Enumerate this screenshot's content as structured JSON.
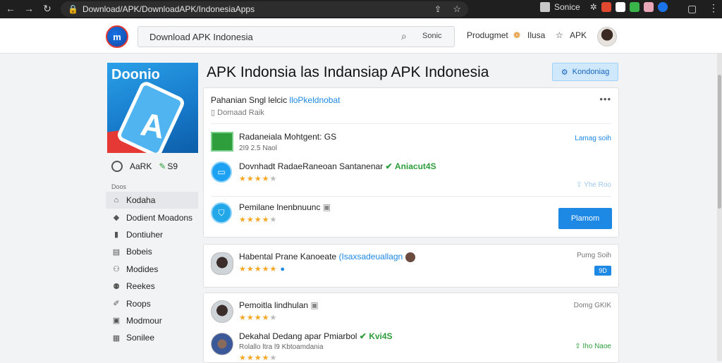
{
  "browser": {
    "url": "Download/APK/DownloadAPK/IndonesiaApps",
    "profile_label": "Sonice"
  },
  "header": {
    "logo_text": "m",
    "search_value": "Download APK Indonesia",
    "search_button": "Sonic",
    "links": [
      "Produgmet",
      "Ilusa",
      "APK"
    ]
  },
  "hero": {
    "title": "Doonio",
    "letter": "A"
  },
  "left": {
    "stats": [
      "AaRK",
      "S9"
    ],
    "section_label": "Doos",
    "items": [
      {
        "icon": "home-icon",
        "label": "Kodaha"
      },
      {
        "icon": "tag-icon",
        "label": "Dodient Moadons"
      },
      {
        "icon": "chart-icon",
        "label": "Dontiuher"
      },
      {
        "icon": "doc-icon",
        "label": "Bobeis"
      },
      {
        "icon": "users-icon",
        "label": "Modides"
      },
      {
        "icon": "people-icon",
        "label": "Reekes"
      },
      {
        "icon": "pen-icon",
        "label": "Roops"
      },
      {
        "icon": "monitor-icon",
        "label": "Modmour"
      },
      {
        "icon": "grid-icon",
        "label": "Sonilee"
      }
    ]
  },
  "main": {
    "page_title": "APK Indonsia las Indansiap APK Indonesia",
    "top_button": "Kondoniag",
    "card1": {
      "head_prefix": "Pahanian Sngl lelcic",
      "head_highlight": "lloPkeldnobat",
      "sub": "Domaad Raik",
      "rows": [
        {
          "title": "Radaneiala Mohtgent: GS",
          "meta": "2I9 2.5 Naol",
          "right": "Lamag soih"
        },
        {
          "title": "Dovnhadt RadaeRaneoan Santanenar",
          "title_green": "Aniacut4S",
          "stars": 4,
          "right": "Yhe Roo"
        },
        {
          "title": "Pemilane lnenbnuunc",
          "stars": 4,
          "button": "Plamom"
        }
      ]
    },
    "card2": {
      "title": "Habental Prane Kanoeate",
      "title_blue": "(Isaxsadeuallagn",
      "stars": 5,
      "right": "Pumg Soih",
      "badge": "9D"
    },
    "card3": {
      "rows": [
        {
          "title": "Pemoitla lindhulan",
          "stars": 4,
          "right": "Domg GKIK"
        },
        {
          "title": "Dekahal Dedang apar Pmiarbol",
          "title_green": "Kvi4S",
          "meta": "Rolallo ltra l9 Kbtoamdania",
          "stars": 4,
          "right": "Iho Naoe"
        }
      ]
    }
  }
}
